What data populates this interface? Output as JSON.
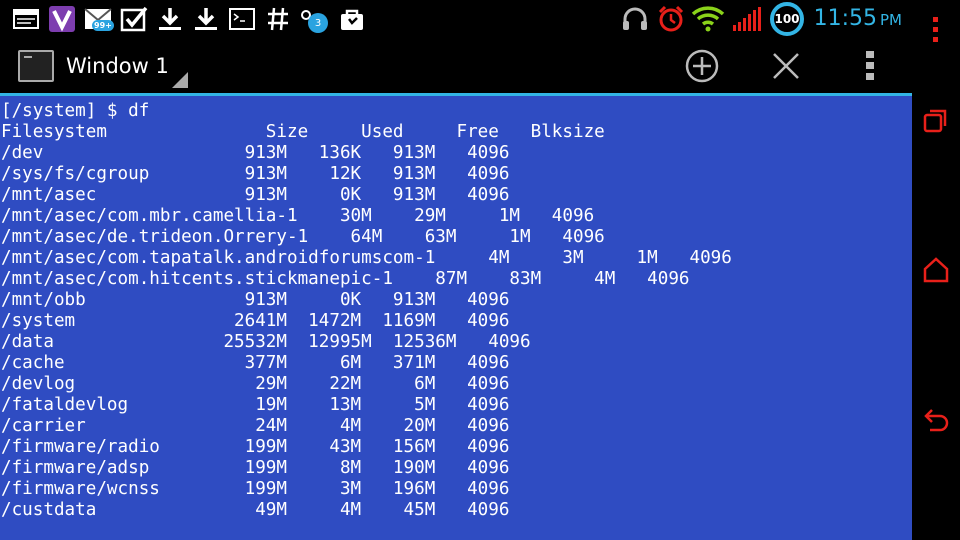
{
  "status_bar": {
    "notification_count_badge": "99+",
    "tag_count_badge": "3",
    "battery_level": "100",
    "time": "11:55",
    "ampm": "PM",
    "icons": [
      "window-icon",
      "viber-icon",
      "gmail-icon",
      "check-icon",
      "download-icon",
      "download-icon",
      "terminal-icon",
      "hashtag-icon",
      "tags-icon",
      "shopping-bag-icon",
      "headphones-icon",
      "alarm-icon",
      "wifi-icon",
      "signal-icon",
      "battery-icon"
    ]
  },
  "action_bar": {
    "title": "Window 1",
    "actions": [
      "add-window-icon",
      "close-window-icon",
      "overflow-menu-icon"
    ]
  },
  "terminal": {
    "background_color": "#2f4cc2",
    "text_color": "#ffffff",
    "lines": [
      "[/system] $ df",
      "Filesystem               Size     Used     Free   Blksize",
      "/dev                   913M   136K   913M   4096",
      "/sys/fs/cgroup         913M    12K   913M   4096",
      "/mnt/asec              913M     0K   913M   4096",
      "/mnt/asec/com.mbr.camellia-1    30M    29M     1M   4096",
      "/mnt/asec/de.trideon.Orrery-1    64M    63M     1M   4096",
      "/mnt/asec/com.tapatalk.androidforumscom-1     4M     3M     1M   4096",
      "/mnt/asec/com.hitcents.stickmanepic-1    87M    83M     4M   4096",
      "/mnt/obb               913M     0K   913M   4096",
      "/system               2641M  1472M  1169M   4096",
      "/data                25532M  12995M  12536M   4096",
      "/cache                 377M     6M   371M   4096",
      "/devlog                 29M    22M     6M   4096",
      "/fataldevlog            19M    13M     5M   4096",
      "/carrier                24M     4M    20M   4096",
      "/firmware/radio        199M    43M   156M   4096",
      "/firmware/adsp         199M     8M   190M   4096",
      "/firmware/wcnss        199M     3M   196M   4096",
      "/custdata               49M     4M    45M   4096"
    ]
  },
  "nav_bar": {
    "color": "#e8201a",
    "buttons": [
      "recent-apps-icon",
      "home-icon",
      "back-icon"
    ]
  }
}
